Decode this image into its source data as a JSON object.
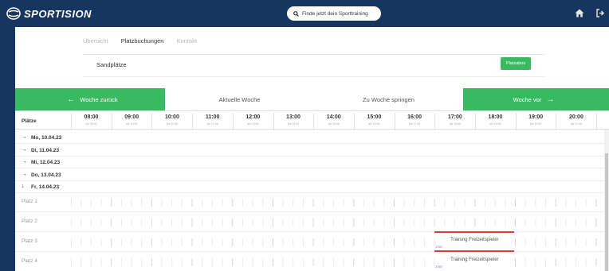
{
  "brand": "SPORTISION",
  "search": {
    "label": "Finde jetzt dein Sporttraining"
  },
  "tabs": [
    "Übersicht",
    "Platzbuchungen",
    "Kontakt"
  ],
  "active_tab": "Platzbuchungen",
  "venue": "Sandplätze",
  "platz_button": "Platzabos",
  "nav": {
    "back": "Woche zurück",
    "current": "Aktuelle Woche",
    "jump": "Zu Woche springen",
    "forward": "Woche vor"
  },
  "grid": {
    "header_label": "Plätze",
    "hours": [
      {
        "h": "08:00",
        "s": "bis 09:00"
      },
      {
        "h": "09:00",
        "s": "bis 10:00"
      },
      {
        "h": "10:00",
        "s": "bis 11:00"
      },
      {
        "h": "11:00",
        "s": "bis 12:00"
      },
      {
        "h": "12:00",
        "s": "bis 13:00"
      },
      {
        "h": "13:00",
        "s": "bis 14:00"
      },
      {
        "h": "14:00",
        "s": "bis 15:00"
      },
      {
        "h": "15:00",
        "s": "bis 16:00"
      },
      {
        "h": "16:00",
        "s": "bis 17:00"
      },
      {
        "h": "17:00",
        "s": "bis 18:00"
      },
      {
        "h": "18:00",
        "s": "bis 19:00"
      },
      {
        "h": "19:00",
        "s": "bis 20:00"
      },
      {
        "h": "20:00",
        "s": "bis 21:00"
      },
      {
        "h": "2",
        "s": ""
      }
    ],
    "days": [
      {
        "arrow": "→",
        "label": "Mo, 10.04.23"
      },
      {
        "arrow": "→",
        "label": "Di, 11.04.23"
      },
      {
        "arrow": "→",
        "label": "Mi, 12.04.23"
      },
      {
        "arrow": "→",
        "label": "Do, 13.04.23"
      },
      {
        "arrow": "↓",
        "label": "Fr, 14.04.23"
      }
    ],
    "courts": [
      "Platz 1",
      "Platz 2",
      "Platz 3",
      "Platz 4"
    ],
    "bookings": [
      {
        "court": "Platz 3",
        "title": "Training Freizeitspieler",
        "sub": "27/07"
      },
      {
        "court": "Platz 4",
        "title": "Training Freizeitspieler",
        "sub": "27/07"
      }
    ]
  },
  "colors": {
    "navy": "#16355f",
    "green": "#3aba60",
    "booking_line": "#e03a3a"
  }
}
